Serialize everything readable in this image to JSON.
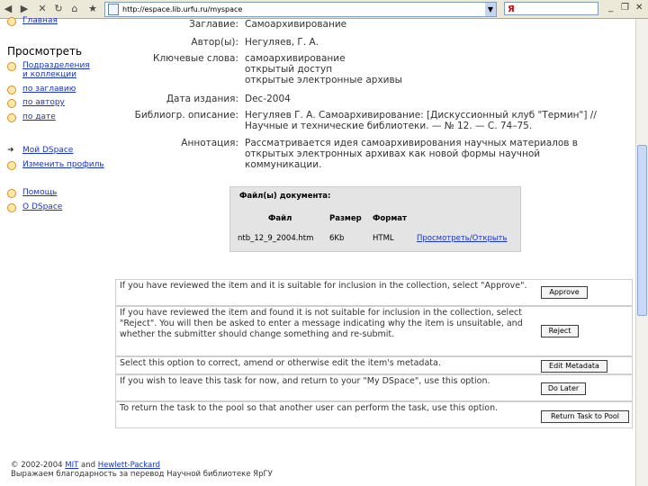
{
  "browser": {
    "address": "http://espace.lib.urfu.ru/myspace",
    "search_logo": "Я"
  },
  "sidebar": {
    "home": "Главная",
    "browse_heading": "Просмотреть",
    "browse_items": [
      [
        "Подразделения",
        "и коллекции"
      ],
      [
        "по заглавию"
      ],
      [
        "по автору"
      ],
      [
        "по дате"
      ]
    ],
    "user_items": [
      "Мой DSpace",
      "Изменить профиль"
    ],
    "help_items": [
      "Помощь",
      "О DSpace"
    ]
  },
  "item": {
    "title_label": "Заглавие:",
    "title": "Самоархивирование",
    "authors_label": "Автор(ы):",
    "authors": "Негуляев, Г. А.",
    "keywords_label": "Ключевые слова:",
    "keywords": [
      "самоархивирование",
      "открытый доступ",
      "открытые электронные архивы"
    ],
    "date_label": "Дата издания:",
    "date": "Dec-2004",
    "citation_label": "Библиогр. описание:",
    "citation_lines": [
      "Негуляев Г. А. Самоархивирование: [Дискуссионный клуб \"Термин\"] //",
      "Научные и технические библиотеки. — № 12. — С. 74–75."
    ],
    "abstract_label": "Аннотация:",
    "abstract_lines": [
      "Рассматривается идея самоархивирования научных материалов в",
      "открытых электронных архивах как новой формы научной",
      "коммуникации."
    ]
  },
  "files": {
    "heading": "Файл(ы) документа:",
    "columns": [
      "Файл",
      "Размер",
      "Формат"
    ],
    "row": {
      "file": "ntb_12_9_2004.htm",
      "size": "6Kb",
      "format": "HTML",
      "action": "Просмотреть/Открыть"
    }
  },
  "tasks": [
    {
      "text": "If you have reviewed the item and it is suitable for inclusion in the collection, select \"Approve\".",
      "button": "Approve"
    },
    {
      "text": "If you have reviewed the item and found it is not suitable for inclusion in the collection, select \"Reject\". You will then be asked to enter a message indicating why the item is unsuitable, and whether the submitter should change something and re-submit.",
      "button": "Reject"
    },
    {
      "text": "Select this option to correct, amend or otherwise edit the item's metadata.",
      "button": "Edit Metadata"
    },
    {
      "text": "If you wish to leave this task for now, and return to your \"My DSpace\", use this option.",
      "button": "Do Later"
    },
    {
      "text": "To return the task to the pool so that another user can perform the task, use this option.",
      "button": "Return Task to Pool"
    }
  ],
  "footer": {
    "copyright": "© 2002-2004",
    "mit": "MIT",
    "and": "and",
    "hp": "Hewlett-Packard",
    "line2": "Выражаем благодарность за перевод Научной библиотеке ЯрГУ"
  }
}
